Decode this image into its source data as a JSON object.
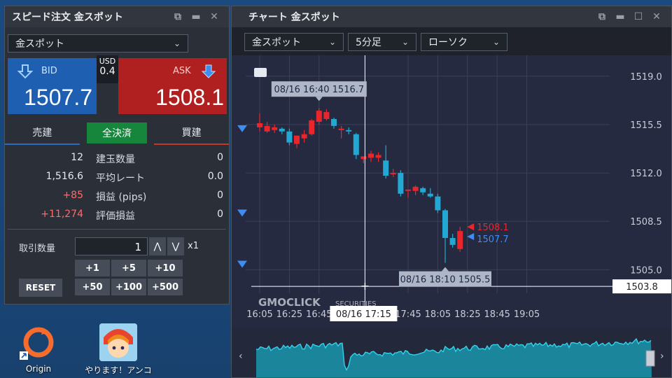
{
  "speed_window": {
    "title": "スピード注文 金スポット",
    "symbol": "金スポット",
    "bid": {
      "label": "BID",
      "price": "1507.7"
    },
    "ask": {
      "label": "ASK",
      "price": "1508.1"
    },
    "spread": {
      "currency": "USD",
      "value": "0.4"
    },
    "tabs": [
      "売建",
      "全決済",
      "買建"
    ],
    "stats": [
      {
        "left": "12",
        "label": "建玉数量",
        "right": "0"
      },
      {
        "left": "1,516.6",
        "label": "平均レート",
        "right": "0.0"
      },
      {
        "left": "+85",
        "label": "損益 (pips)",
        "right": "0"
      },
      {
        "left": "+11,274",
        "label": "評価損益",
        "right": "0"
      }
    ],
    "qty_label": "取引数量",
    "qty_value": "1",
    "multiplier": "x1",
    "inc_buttons": [
      "+1",
      "+5",
      "+10",
      "+50",
      "+100",
      "+500"
    ],
    "reset_label": "RESET"
  },
  "chart_window": {
    "title": "チャート 金スポット",
    "symbol_select": "金スポット",
    "interval_select": "5分足",
    "type_select": "ローソク",
    "watermark": "GMOCLICK",
    "watermark_suffix": "SECURITIES",
    "crosshair_price": "1503.8",
    "crosshair_time": "08/16 17:15",
    "tooltip_high": "08/16 16:40 1516.7",
    "tooltip_low": "08/16 18:10 1505.5",
    "ask_line": "1508.1",
    "bid_line": "1507.7"
  },
  "chart_data": {
    "type": "candlestick",
    "y_ticks": [
      "1519.0",
      "1515.5",
      "1512.0",
      "1508.5",
      "1505.0"
    ],
    "ylim": [
      1503.3,
      1520.0
    ],
    "x_ticks": [
      "16:05",
      "16:25",
      "16:45",
      "17:45",
      "18:05",
      "18:25",
      "18:45",
      "19:05"
    ],
    "candles": [
      {
        "time": "16:05",
        "o": 1515.3,
        "h": 1516.3,
        "l": 1515.0,
        "c": 1515.6
      },
      {
        "time": "16:10",
        "o": 1515.0,
        "h": 1515.7,
        "l": 1514.9,
        "c": 1515.4
      },
      {
        "time": "16:15",
        "o": 1515.1,
        "h": 1515.5,
        "l": 1514.9,
        "c": 1515.3
      },
      {
        "time": "16:20",
        "o": 1515.2,
        "h": 1515.3,
        "l": 1514.8,
        "c": 1515.0
      },
      {
        "time": "16:25",
        "o": 1515.0,
        "h": 1515.2,
        "l": 1514.0,
        "c": 1514.2
      },
      {
        "time": "16:30",
        "o": 1514.1,
        "h": 1514.3,
        "l": 1513.8,
        "c": 1514.7
      },
      {
        "time": "16:35",
        "o": 1514.5,
        "h": 1515.1,
        "l": 1514.2,
        "c": 1514.8
      },
      {
        "time": "16:40",
        "o": 1514.8,
        "h": 1515.9,
        "l": 1514.7,
        "c": 1515.8
      },
      {
        "time": "16:45",
        "o": 1515.7,
        "h": 1516.7,
        "l": 1515.5,
        "c": 1516.5
      },
      {
        "time": "16:50",
        "o": 1515.9,
        "h": 1516.6,
        "l": 1515.8,
        "c": 1516.4
      },
      {
        "time": "16:55",
        "o": 1515.9,
        "h": 1516.0,
        "l": 1515.2,
        "c": 1515.4
      },
      {
        "time": "17:00",
        "o": 1515.2,
        "h": 1515.4,
        "l": 1514.5,
        "c": 1515.2
      },
      {
        "time": "17:05",
        "o": 1515.1,
        "h": 1515.3,
        "l": 1514.8,
        "c": 1515.0
      },
      {
        "time": "17:10",
        "o": 1514.8,
        "h": 1514.9,
        "l": 1513.0,
        "c": 1513.3
      },
      {
        "time": "17:15",
        "o": 1513.0,
        "h": 1513.2,
        "l": 1512.7,
        "c": 1513.2
      },
      {
        "time": "17:20",
        "o": 1513.1,
        "h": 1513.6,
        "l": 1512.8,
        "c": 1513.4
      },
      {
        "time": "17:25",
        "o": 1513.1,
        "h": 1513.5,
        "l": 1512.8,
        "c": 1513.3
      },
      {
        "time": "17:30",
        "o": 1512.9,
        "h": 1514.0,
        "l": 1511.6,
        "c": 1511.8
      },
      {
        "time": "17:35",
        "o": 1512.0,
        "h": 1512.3,
        "l": 1511.7,
        "c": 1512.0
      },
      {
        "time": "17:40",
        "o": 1512.0,
        "h": 1512.2,
        "l": 1510.3,
        "c": 1510.5
      },
      {
        "time": "17:45",
        "o": 1510.7,
        "h": 1510.8,
        "l": 1510.2,
        "c": 1510.8
      },
      {
        "time": "17:50",
        "o": 1510.7,
        "h": 1511.1,
        "l": 1510.4,
        "c": 1511.0
      },
      {
        "time": "17:55",
        "o": 1510.9,
        "h": 1511.0,
        "l": 1510.4,
        "c": 1510.6
      },
      {
        "time": "18:00",
        "o": 1510.5,
        "h": 1510.9,
        "l": 1510.2,
        "c": 1510.3
      },
      {
        "time": "18:05",
        "o": 1510.3,
        "h": 1510.5,
        "l": 1509.1,
        "c": 1509.3
      },
      {
        "time": "18:10",
        "o": 1509.3,
        "h": 1509.4,
        "l": 1505.5,
        "c": 1507.3
      },
      {
        "time": "18:15",
        "o": 1507.3,
        "h": 1507.6,
        "l": 1506.6,
        "c": 1506.8
      },
      {
        "time": "18:20",
        "o": 1506.5,
        "h": 1508.1,
        "l": 1506.3,
        "c": 1507.8
      }
    ],
    "ask_line": 1508.1,
    "bid_line": 1507.7,
    "crosshair_price": 1503.8
  },
  "desktop": {
    "icons": [
      {
        "label": "Origin"
      },
      {
        "label": "やります！アンコちゃ"
      }
    ]
  },
  "colors": {
    "bid_blue": "#1e5fb1",
    "ask_red": "#b02020",
    "candle_up": "#e8262b",
    "candle_down": "#22a8d2",
    "chart_bg": "#252a40",
    "active_tab": "#17863d"
  }
}
